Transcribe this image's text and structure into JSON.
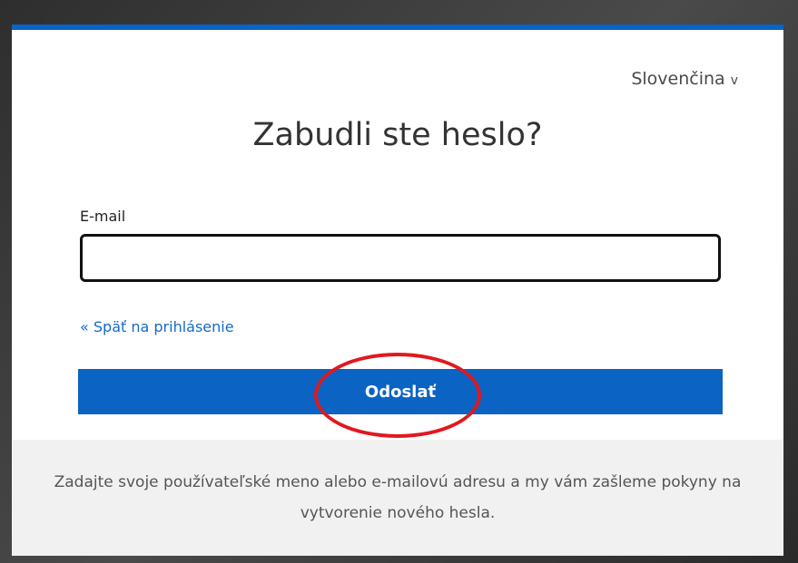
{
  "language": {
    "label": "Slovenčina",
    "caret": "v"
  },
  "title": "Zabudli ste heslo?",
  "form": {
    "email_label": "E-mail",
    "email_value": "",
    "back_link": "« Späť na prihlásenie",
    "submit_label": "Odoslať"
  },
  "info": "Zadajte svoje používateľské meno alebo e-mailovú adresu a my vám zašleme pokyny na vytvorenie nového hesla.",
  "colors": {
    "accent": "#0b63c3",
    "link": "#1769c8",
    "highlight": "#e0191e",
    "panel": "#f1f1f1"
  }
}
